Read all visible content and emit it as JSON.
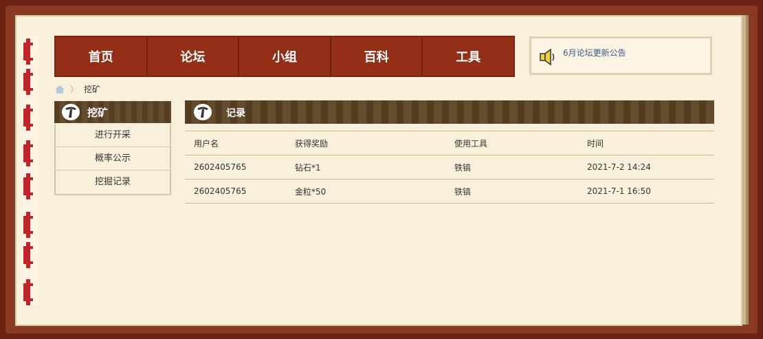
{
  "nav": {
    "items": [
      "首页",
      "论坛",
      "小组",
      "百科",
      "工具"
    ]
  },
  "notice": {
    "text": "6月论坛更新公告"
  },
  "breadcrumb": {
    "current": "挖矿"
  },
  "sidebar": {
    "title": "挖矿",
    "items": [
      "进行开采",
      "概率公示",
      "挖掘记录"
    ]
  },
  "main": {
    "title": "记录",
    "columns": [
      "用户名",
      "获得奖励",
      "使用工具",
      "时间"
    ],
    "rows": [
      [
        "2602405765",
        "钻石*1",
        "铁镐",
        "2021-7-2 14:24"
      ],
      [
        "2602405765",
        "金粒*50",
        "铁镐",
        "2021-7-1 16:50"
      ]
    ]
  },
  "colors": {
    "nav_bg": "#922f16",
    "header_bg": "#5c4324",
    "page_bg": "#f9f0dc",
    "ring": "#c0242a"
  }
}
